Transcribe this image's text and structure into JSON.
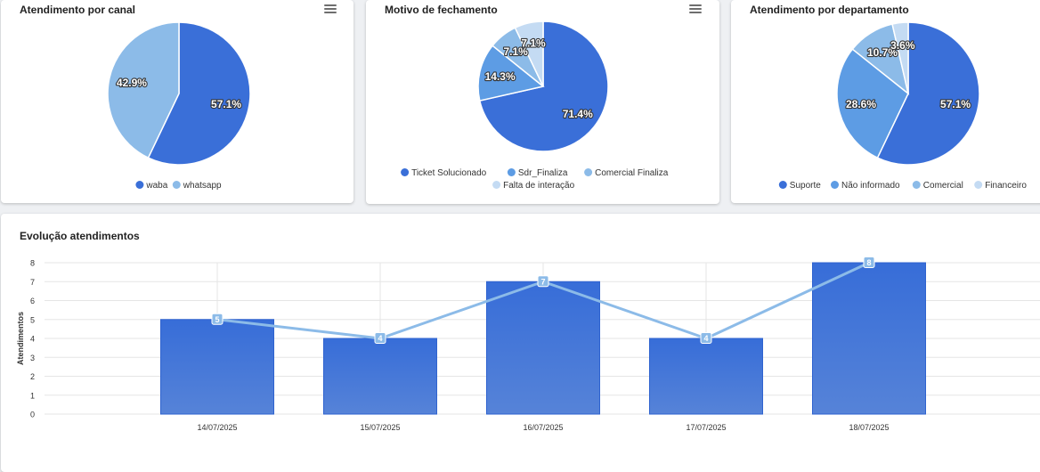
{
  "charts": [
    {
      "title": "Atendimento por canal",
      "type": "pie",
      "labels": [
        "waba",
        "whatsapp"
      ],
      "values": [
        57.1,
        42.9
      ],
      "colors": [
        "#3a6fd8",
        "#8cbbe8"
      ]
    },
    {
      "title": "Motivo de fechamento",
      "type": "pie",
      "labels": [
        "Ticket Solucionado",
        "Sdr_Finaliza",
        "Comercial Finaliza",
        "Falta de interação"
      ],
      "values": [
        71.4,
        14.3,
        7.1,
        7.1
      ],
      "colors": [
        "#3a6fd8",
        "#5d9ce4",
        "#8cbbe8",
        "#c4dbf3"
      ]
    },
    {
      "title": "Atendimento por departamento",
      "type": "pie",
      "labels": [
        "Suporte",
        "Não informado",
        "Comercial",
        "Financeiro"
      ],
      "values": [
        57.1,
        28.6,
        10.7,
        3.6
      ],
      "colors": [
        "#3a6fd8",
        "#5d9ce4",
        "#8cbbe8",
        "#c4dbf3"
      ]
    }
  ],
  "chart_data": {
    "type": "bar",
    "title": "Evolução atendimentos",
    "ylabel": "Atendimentos",
    "xlabel": "",
    "categories": [
      "14/07/2025",
      "15/07/2025",
      "16/07/2025",
      "17/07/2025",
      "18/07/2025"
    ],
    "series": [
      {
        "type": "bar",
        "values": [
          5,
          4,
          7,
          4,
          8
        ],
        "color": "#3a6fd8"
      },
      {
        "type": "line",
        "values": [
          5,
          4,
          7,
          4,
          8
        ],
        "color": "#8cbbe8"
      }
    ],
    "ylim": [
      0,
      8
    ],
    "yticks": [
      0,
      1,
      2,
      3,
      4,
      5,
      6,
      7,
      8
    ],
    "grid": true
  }
}
